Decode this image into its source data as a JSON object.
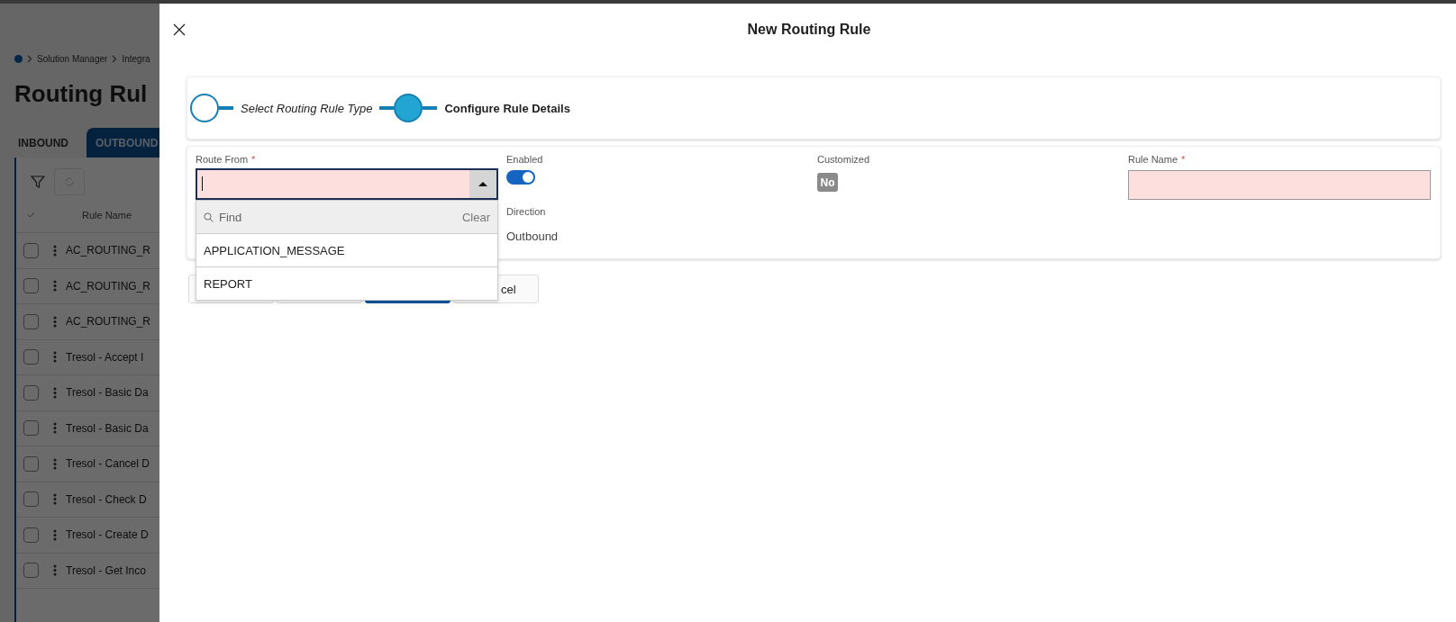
{
  "background_page": {
    "breadcrumb": [
      "Solution Manager",
      "Integra"
    ],
    "title": "Routing Rul",
    "tabs": [
      {
        "label": "INBOUND",
        "selected": false
      },
      {
        "label": "OUTBOUND",
        "selected": true
      }
    ],
    "table": {
      "columns": [
        "Rule Name"
      ],
      "rows": [
        {
          "rule_name": "AC_ROUTING_R",
          "checked": false
        },
        {
          "rule_name": "AC_ROUTING_R",
          "checked": false
        },
        {
          "rule_name": "AC_ROUTING_R",
          "checked": false
        },
        {
          "rule_name": "Tresol - Accept I",
          "checked": false
        },
        {
          "rule_name": "Tresol - Basic Da",
          "checked": false
        },
        {
          "rule_name": "Tresol - Basic Da",
          "checked": false
        },
        {
          "rule_name": "Tresol - Cancel D",
          "checked": false
        },
        {
          "rule_name": "Tresol - Check D",
          "checked": false
        },
        {
          "rule_name": "Tresol - Create D",
          "checked": false
        },
        {
          "rule_name": "Tresol - Get Inco",
          "checked": false
        }
      ]
    }
  },
  "modal": {
    "title": "New Routing Rule",
    "steps": [
      {
        "label": "Select Routing Rule Type",
        "selected": false
      },
      {
        "label": "Configure Rule Details",
        "selected": true
      }
    ],
    "form": {
      "route_from": {
        "label": "Route From",
        "required_mark": "*",
        "focused": true,
        "dropdown": {
          "search_placeholder": "Find",
          "clear": "Clear",
          "options": [
            {
              "label": "APPLICATION_MESSAGE",
              "selected": false
            },
            {
              "label": "REPORT",
              "selected": false
            }
          ]
        }
      },
      "enabled": {
        "label": "Enabled",
        "on": true
      },
      "customized": {
        "label": "Customized",
        "value": "No"
      },
      "rule_name": {
        "label": "Rule Name",
        "required_mark": "*"
      },
      "direction": {
        "label": "Direction",
        "value": "Outbound"
      }
    },
    "buttons": [
      {
        "kind": "plain"
      },
      {
        "kind": "plain"
      },
      {
        "kind": "primary"
      },
      {
        "kind": "plain",
        "label": "cel"
      }
    ]
  }
}
